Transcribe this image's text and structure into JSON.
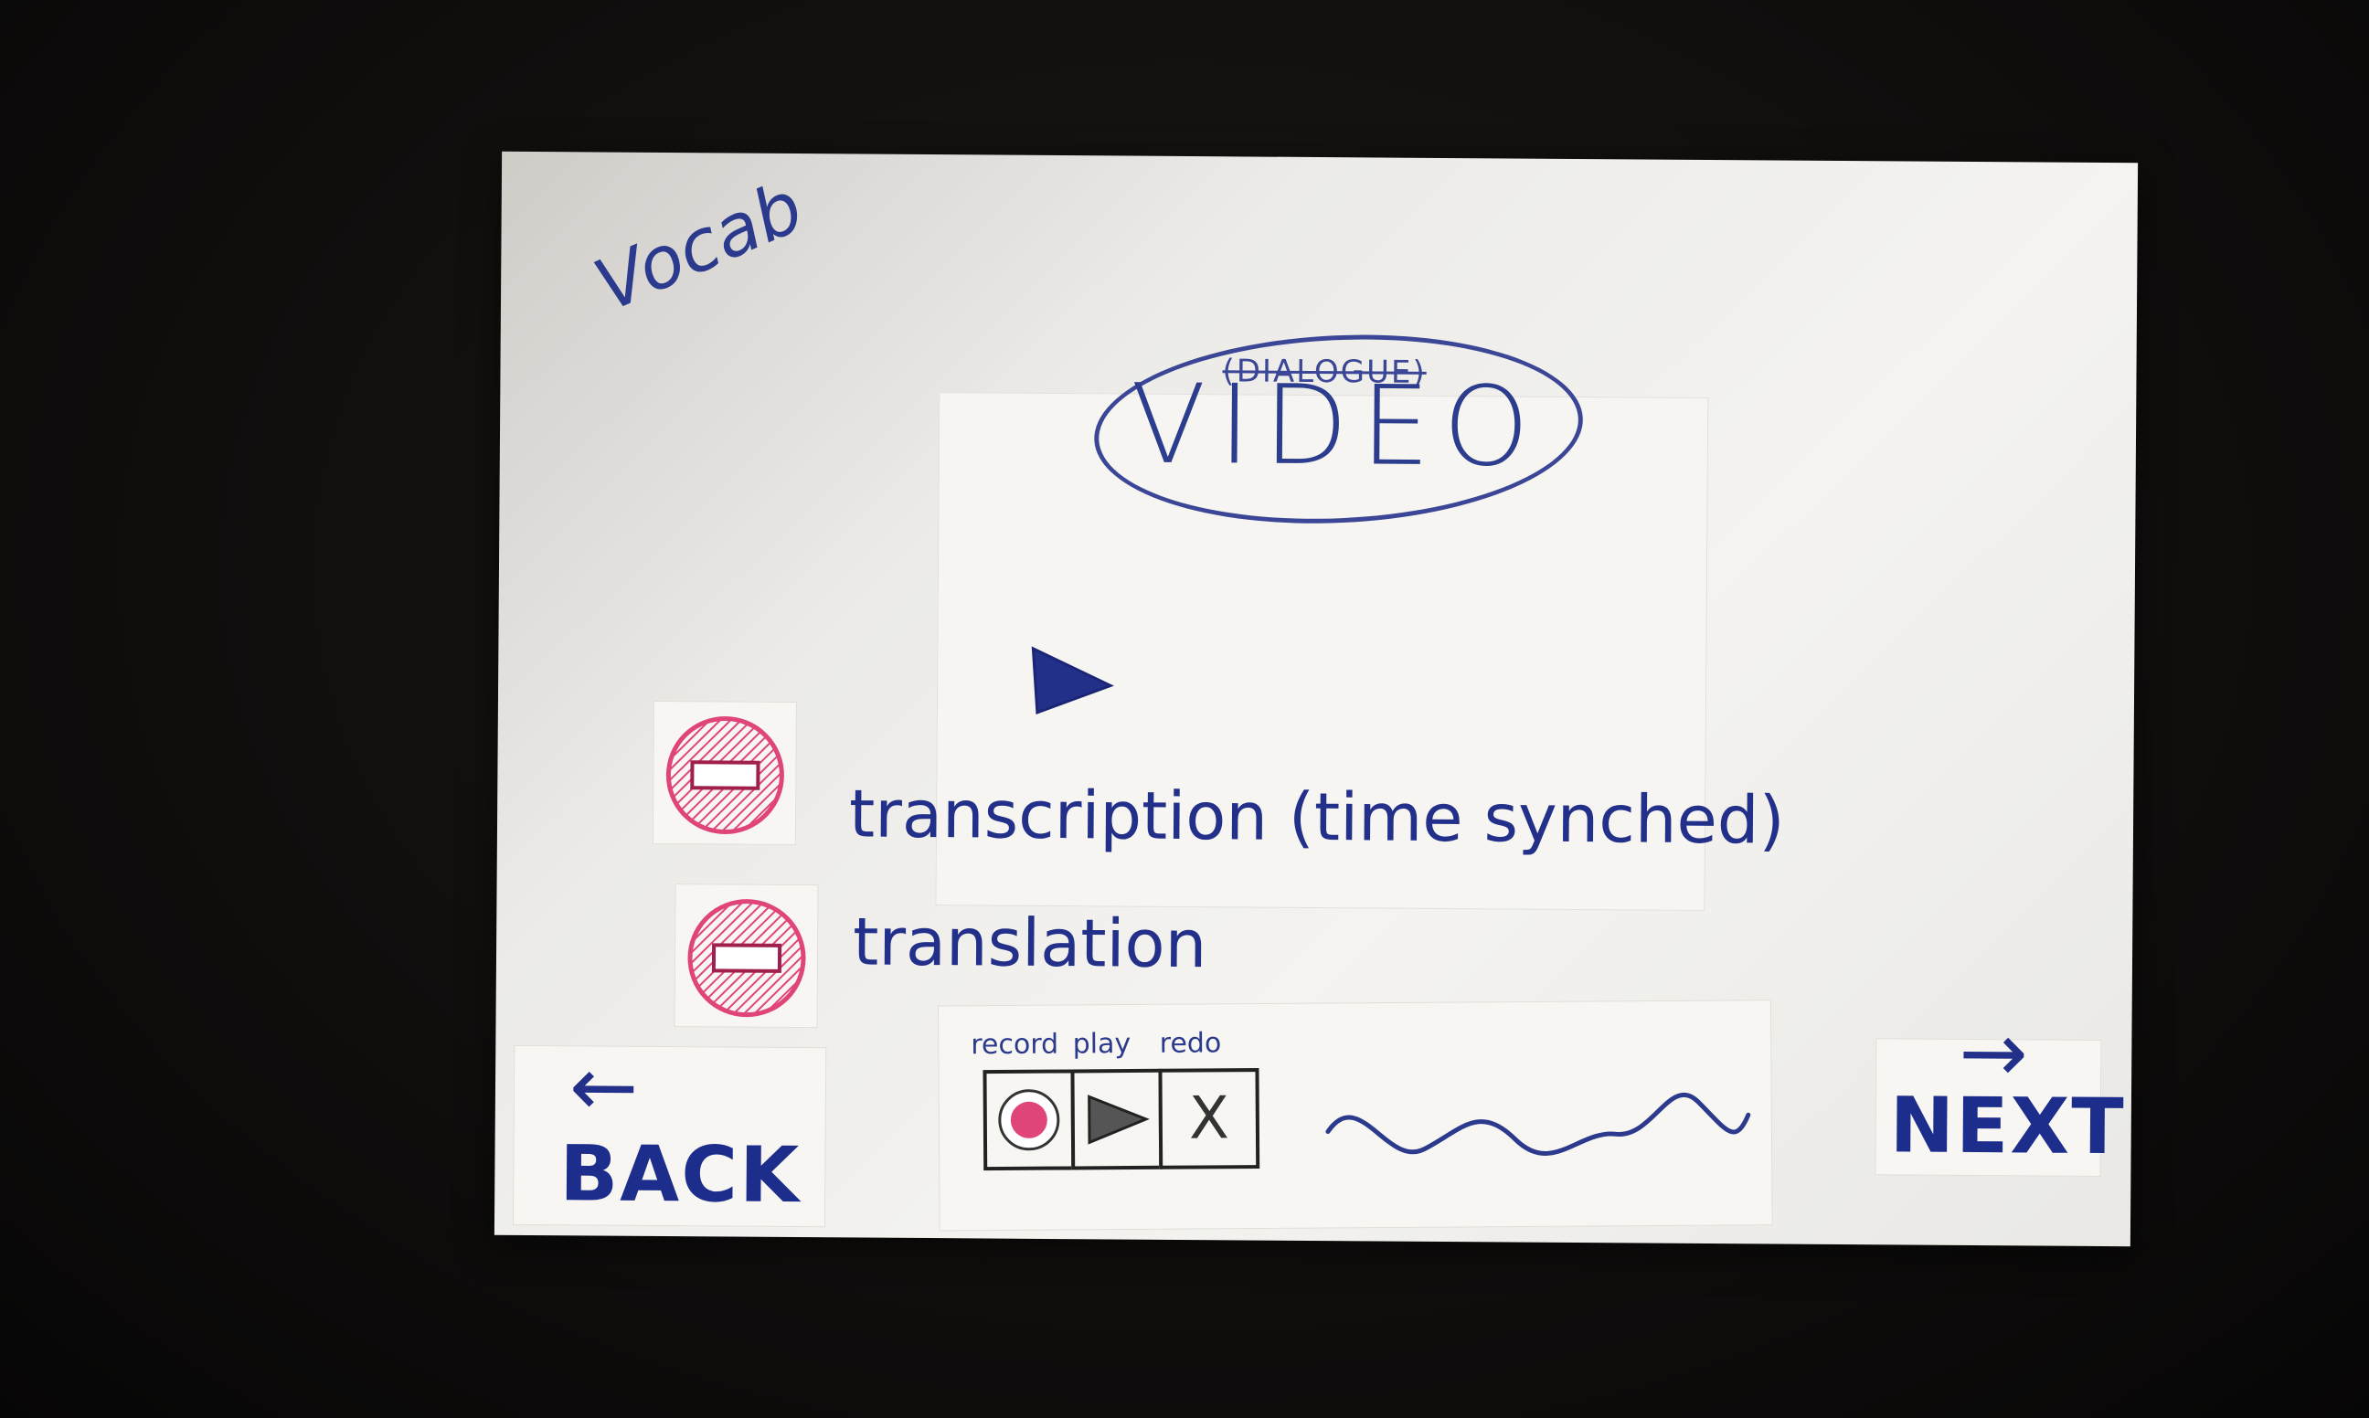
{
  "vocab_label": "Vocab",
  "video": {
    "note": "(DIALOGUE)",
    "title": "VIDEO"
  },
  "lines": {
    "transcription": "transcription (time synched)",
    "translation": "translation"
  },
  "controls": {
    "record_label": "record",
    "play_label": "play",
    "redo_label": "redo",
    "redo_glyph": "X"
  },
  "nav": {
    "back_label": "BACK",
    "back_arrow": "←",
    "next_label": "NEXT",
    "next_arrow": "→"
  },
  "colors": {
    "ink_blue": "#23308a",
    "ink_pink": "#e0457a"
  }
}
